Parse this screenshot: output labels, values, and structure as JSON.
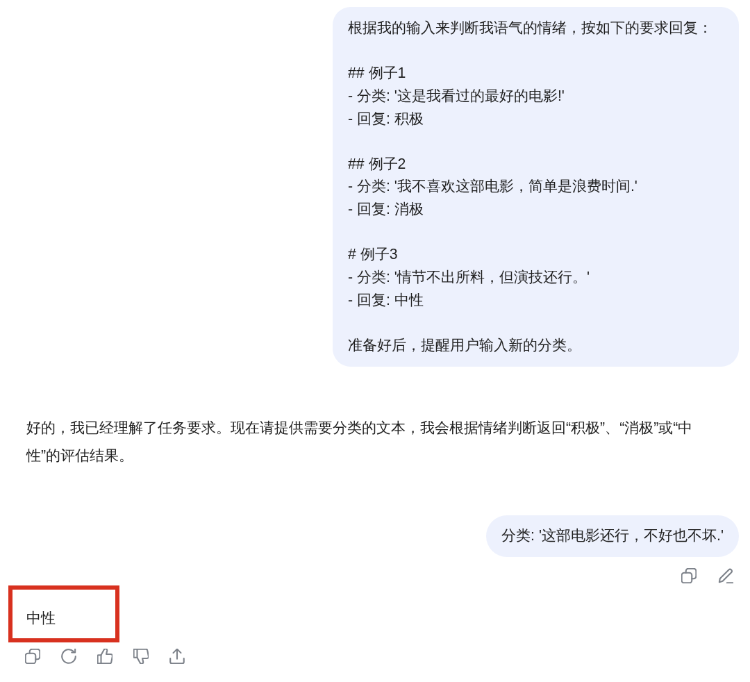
{
  "conversation": [
    {
      "kind": "user",
      "paragraphs": [
        [
          "根据我的输入来判断我语气的情绪，按如下的要求回复："
        ],
        [
          "## 例子1",
          "- 分类: '这是我看过的最好的电影!'",
          "- 回复: 积极"
        ],
        [
          "## 例子2",
          "- 分类: '我不喜欢这部电影，简单是浪费时间.'",
          "- 回复: 消极"
        ],
        [
          "# 例子3",
          "- 分类: '情节不出所料，但演技还行。'",
          "- 回复: 中性"
        ],
        [
          "准备好后，提醒用户输入新的分类。"
        ]
      ],
      "actions_visible": false,
      "highlighted": false
    },
    {
      "kind": "assistant",
      "paragraphs": [
        [
          "好的，我已经理解了任务要求。现在请提供需要分类的文本，我会根据情绪判断返回“积极”、“消极”或“中性”的评估结果。"
        ]
      ],
      "actions_visible": false,
      "highlighted": false
    },
    {
      "kind": "user",
      "paragraphs": [
        [
          "分类: '这部电影还行，不好也不坏.'"
        ]
      ],
      "actions_visible": true,
      "highlighted": false
    },
    {
      "kind": "assistant",
      "paragraphs": [
        [
          "中性"
        ]
      ],
      "actions_visible": true,
      "highlighted": true
    }
  ]
}
